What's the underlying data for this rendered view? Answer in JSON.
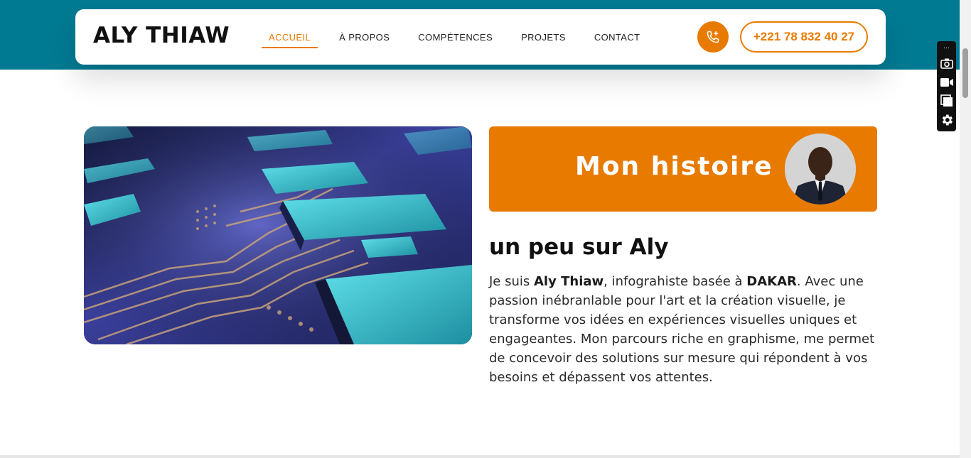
{
  "header": {
    "brand": "ALY THIAW",
    "nav": [
      {
        "label": "ACCUEIL",
        "active": true
      },
      {
        "label": "À PROPOS",
        "active": false
      },
      {
        "label": "COMPÉTENCES",
        "active": false
      },
      {
        "label": "PROJETS",
        "active": false
      },
      {
        "label": "CONTACT",
        "active": false
      }
    ],
    "phone_icon": "phone-plus-icon",
    "phone_number": "+221 78 832 40 27"
  },
  "hero": {
    "image": "circuit-board-image"
  },
  "story": {
    "title": "Mon histoire",
    "avatar": "profile-photo",
    "subtitle": "un peu sur Aly",
    "bio": {
      "intro": "Je suis ",
      "name": "Aly Thiaw",
      "middle": ", infograhiste basée à ",
      "city": "DAKAR",
      "rest": ". Avec une passion inébranlable pour l'art et la création visuelle, je transforme vos idées en expériences visuelles uniques et engageantes. Mon parcours riche en graphisme, me permet de concevoir des solutions sur mesure qui répondent à vos besoins et dépassent vos attentes."
    }
  },
  "colors": {
    "accent": "#e87a00",
    "header_band": "#007a92",
    "text": "#111111"
  },
  "toolbar": {
    "icons": [
      "camera-icon",
      "video-icon",
      "window-icon",
      "gear-icon"
    ]
  }
}
